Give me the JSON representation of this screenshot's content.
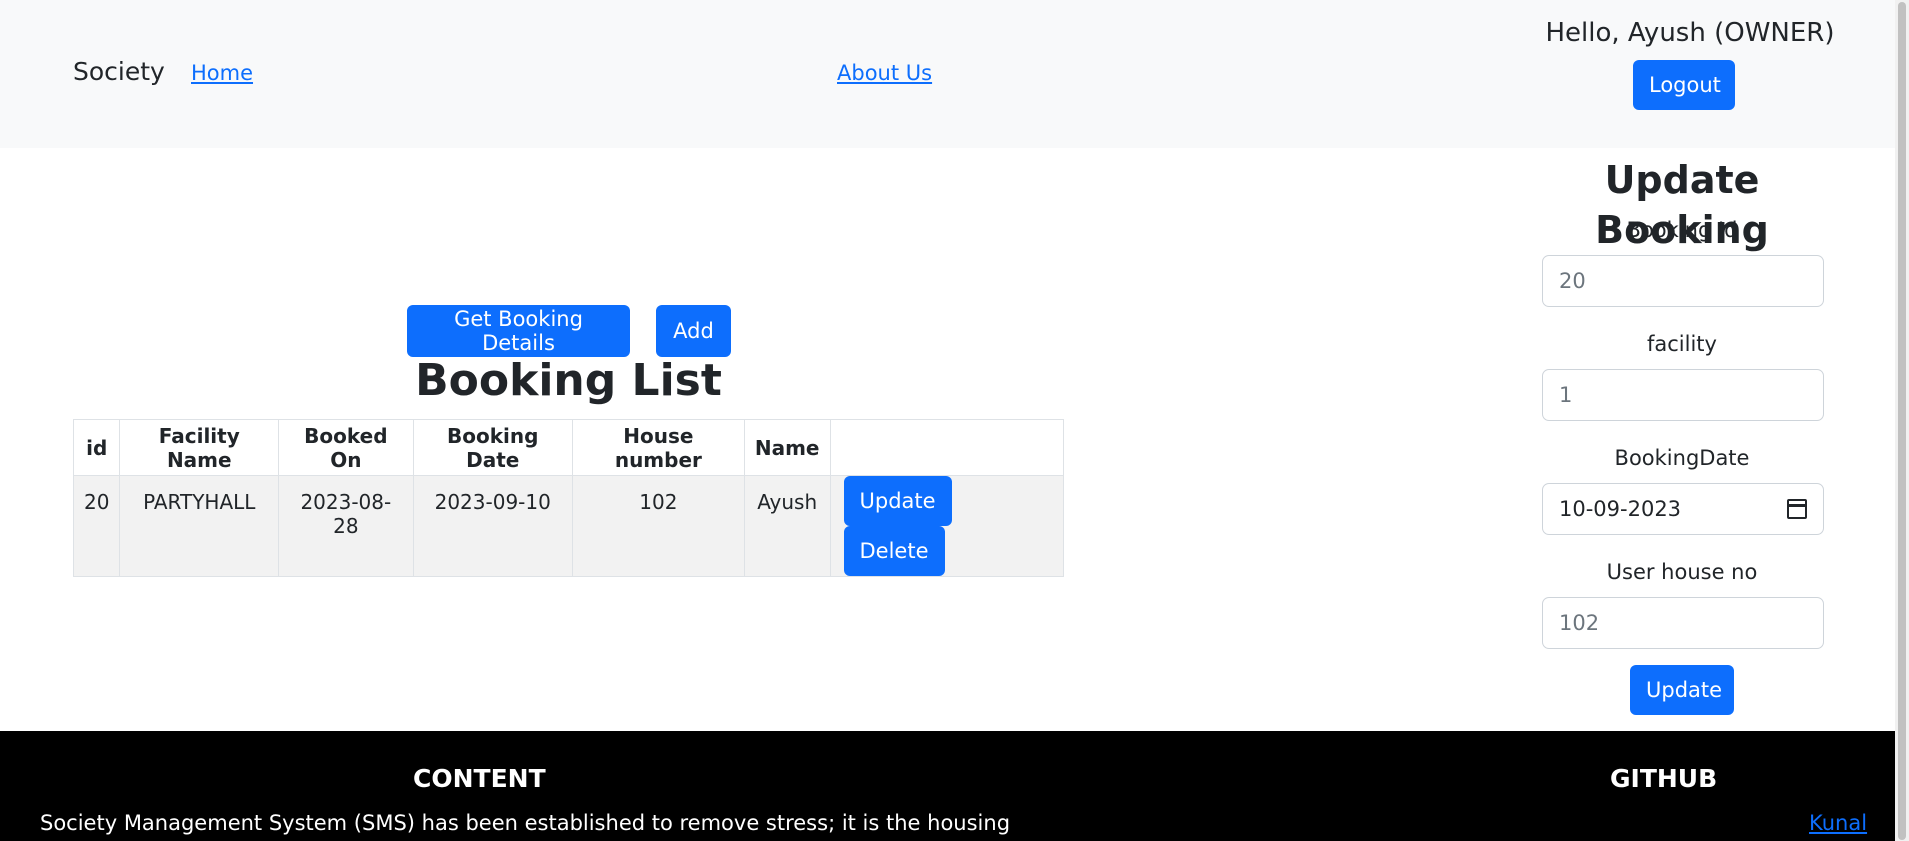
{
  "navbar": {
    "brand": "Society",
    "links": [
      "Home",
      "About Us"
    ],
    "greeting": "Hello, Ayush (OWNER)",
    "logout_label": "Logout"
  },
  "booking_list": {
    "details_button": "Get Booking Details",
    "add_button": "Add",
    "title": "Booking List",
    "columns": [
      "id",
      "Facility Name",
      "Booked On",
      "Booking Date",
      "House number",
      "Name",
      ""
    ],
    "rows": [
      {
        "id": "20",
        "facility_name": "PARTYHALL",
        "booked_on": "2023-08-28",
        "booking_date": "2023-09-10",
        "house_number": "102",
        "name": "Ayush",
        "update_label": "Update",
        "delete_label": "Delete"
      }
    ]
  },
  "update_form": {
    "title": "Update Booking",
    "fields": [
      {
        "label": "Booking Id",
        "value": "20"
      },
      {
        "label": "facility",
        "value": "1"
      },
      {
        "label": "BookingDate",
        "value": "10-09-2023"
      },
      {
        "label": "User house no",
        "value": "102"
      }
    ],
    "submit_label": "Update"
  },
  "footer": {
    "content_heading": "CONTENT",
    "content_text": "Society Management System (SMS) has been established to remove stress; it is the housing",
    "github_heading": "GITHUB",
    "github_link": "Kunal"
  },
  "colors": {
    "primary": "#0d6efd",
    "navbar_bg": "#f8f9fa",
    "footer_bg": "#000000"
  }
}
